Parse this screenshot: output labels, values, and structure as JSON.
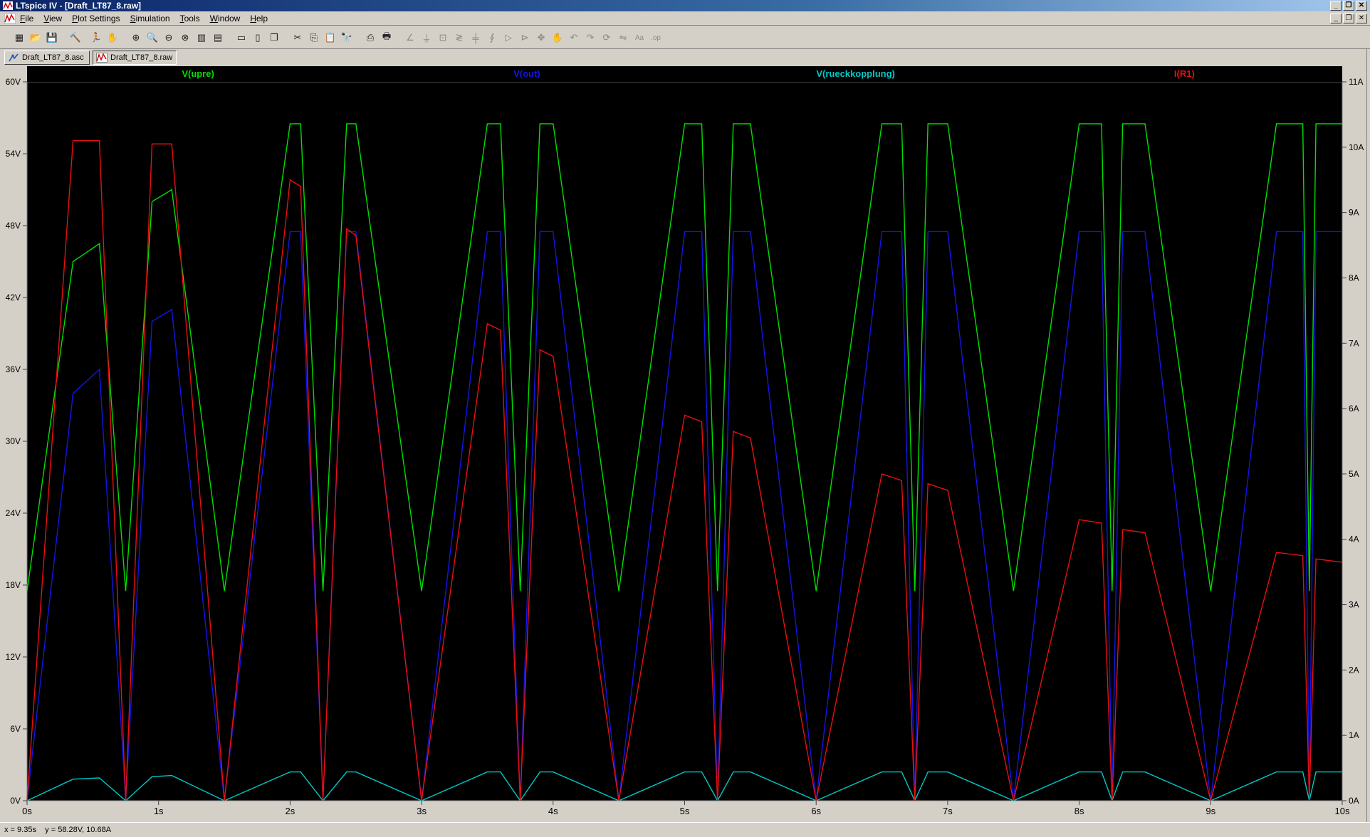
{
  "window": {
    "title": "LTspice IV - [Draft_LT87_8.raw]"
  },
  "menu": [
    "File",
    "View",
    "Plot Settings",
    "Simulation",
    "Tools",
    "Window",
    "Help"
  ],
  "toolbar": {
    "icons": [
      "new-schematic-icon",
      "open-icon",
      "save-icon",
      "control-panel-icon",
      "run-icon",
      "halt-icon",
      "zoom-in-icon",
      "zoom-area-icon",
      "zoom-out-icon",
      "zoom-full-icon",
      "autorange-icon",
      "mark-icon",
      "tile-horizontal-icon",
      "tile-vertical-icon",
      "cascade-icon",
      "cut-icon",
      "copy-icon",
      "paste-icon",
      "find-icon",
      "print-preview-icon",
      "print-icon",
      "wire-icon",
      "ground-icon",
      "label-icon",
      "resistor-icon",
      "capacitor-icon",
      "inductor-icon",
      "diode-icon",
      "component-icon",
      "move-icon",
      "drag-icon",
      "undo-icon",
      "redo-icon",
      "rotate-icon",
      "mirror-icon",
      "text-icon",
      "spice-directive-icon"
    ]
  },
  "tabs": [
    {
      "label": "Draft_LT87_8.asc",
      "icon": "schematic-icon",
      "active": false
    },
    {
      "label": "Draft_LT87_8.raw",
      "icon": "waveform-icon",
      "active": true
    }
  ],
  "status": {
    "text": "x = 9.35s    y = 58.28V, 10.68A"
  },
  "chart_data": {
    "type": "line",
    "x_unit": "s",
    "xlim": [
      0,
      10
    ],
    "x_ticks": [
      "0s",
      "1s",
      "2s",
      "3s",
      "4s",
      "5s",
      "6s",
      "7s",
      "8s",
      "9s",
      "10s"
    ],
    "y_left": {
      "ylim": [
        0,
        60
      ],
      "ticks": [
        "0V",
        "6V",
        "12V",
        "18V",
        "24V",
        "30V",
        "36V",
        "42V",
        "48V",
        "54V",
        "60V"
      ]
    },
    "y_right": {
      "ylim": [
        0,
        11
      ],
      "ticks": [
        "0A",
        "1A",
        "2A",
        "3A",
        "4A",
        "5A",
        "6A",
        "7A",
        "8A",
        "9A",
        "10A",
        "11A"
      ]
    },
    "grid": false,
    "background": "#000000",
    "axis_color": "#808080",
    "series": [
      {
        "name": "V(upre)",
        "color": "#00e000",
        "axis": "left",
        "points": [
          [
            0,
            17.5
          ],
          [
            0.35,
            45
          ],
          [
            0.55,
            46.5
          ],
          [
            0.75,
            17.5
          ],
          [
            0.95,
            50
          ],
          [
            1.1,
            51
          ],
          [
            1.5,
            17.5
          ],
          [
            2.0,
            56.5
          ],
          [
            2.08,
            56.5
          ],
          [
            2.25,
            17.5
          ],
          [
            2.43,
            56.5
          ],
          [
            2.5,
            56.5
          ],
          [
            3.0,
            17.5
          ],
          [
            3.5,
            56.5
          ],
          [
            3.6,
            56.5
          ],
          [
            3.75,
            17.5
          ],
          [
            3.9,
            56.5
          ],
          [
            4.0,
            56.5
          ],
          [
            4.5,
            17.5
          ],
          [
            5.0,
            56.5
          ],
          [
            5.13,
            56.5
          ],
          [
            5.25,
            17.5
          ],
          [
            5.37,
            56.5
          ],
          [
            5.5,
            56.5
          ],
          [
            6.0,
            17.5
          ],
          [
            6.5,
            56.5
          ],
          [
            6.65,
            56.5
          ],
          [
            6.75,
            17.5
          ],
          [
            6.85,
            56.5
          ],
          [
            7.0,
            56.5
          ],
          [
            7.5,
            17.5
          ],
          [
            8.0,
            56.5
          ],
          [
            8.17,
            56.5
          ],
          [
            8.25,
            17.5
          ],
          [
            8.33,
            56.5
          ],
          [
            8.5,
            56.5
          ],
          [
            9.0,
            17.5
          ],
          [
            9.5,
            56.5
          ],
          [
            9.7,
            56.5
          ],
          [
            9.75,
            17.5
          ],
          [
            9.8,
            56.5
          ],
          [
            10.0,
            56.5
          ]
        ]
      },
      {
        "name": "V(out)",
        "color": "#1515e6",
        "axis": "left",
        "points": [
          [
            0,
            0
          ],
          [
            0.35,
            34
          ],
          [
            0.55,
            36
          ],
          [
            0.75,
            0
          ],
          [
            0.95,
            40
          ],
          [
            1.1,
            41
          ],
          [
            1.5,
            0
          ],
          [
            2.0,
            47.5
          ],
          [
            2.08,
            47.5
          ],
          [
            2.25,
            0
          ],
          [
            2.43,
            47.5
          ],
          [
            2.5,
            47.5
          ],
          [
            3.0,
            0
          ],
          [
            3.5,
            47.5
          ],
          [
            3.6,
            47.5
          ],
          [
            3.75,
            0
          ],
          [
            3.9,
            47.5
          ],
          [
            4.0,
            47.5
          ],
          [
            4.5,
            0
          ],
          [
            5.0,
            47.5
          ],
          [
            5.13,
            47.5
          ],
          [
            5.25,
            0
          ],
          [
            5.37,
            47.5
          ],
          [
            5.5,
            47.5
          ],
          [
            6.0,
            0
          ],
          [
            6.5,
            47.5
          ],
          [
            6.65,
            47.5
          ],
          [
            6.75,
            0
          ],
          [
            6.85,
            47.5
          ],
          [
            7.0,
            47.5
          ],
          [
            7.5,
            0
          ],
          [
            8.0,
            47.5
          ],
          [
            8.17,
            47.5
          ],
          [
            8.25,
            0
          ],
          [
            8.33,
            47.5
          ],
          [
            8.5,
            47.5
          ],
          [
            9.0,
            0
          ],
          [
            9.5,
            47.5
          ],
          [
            9.7,
            47.5
          ],
          [
            9.75,
            0
          ],
          [
            9.8,
            47.5
          ],
          [
            10.0,
            47.5
          ]
        ]
      },
      {
        "name": "V(rueckkopplung)",
        "color": "#00c8c8",
        "axis": "left",
        "points": [
          [
            0,
            0
          ],
          [
            0.35,
            1.8
          ],
          [
            0.55,
            1.9
          ],
          [
            0.75,
            0
          ],
          [
            0.95,
            2.0
          ],
          [
            1.1,
            2.1
          ],
          [
            1.5,
            0
          ],
          [
            2.0,
            2.4
          ],
          [
            2.08,
            2.4
          ],
          [
            2.25,
            0
          ],
          [
            2.43,
            2.4
          ],
          [
            2.5,
            2.4
          ],
          [
            3.0,
            0
          ],
          [
            3.5,
            2.4
          ],
          [
            3.6,
            2.4
          ],
          [
            3.75,
            0
          ],
          [
            3.9,
            2.4
          ],
          [
            4.0,
            2.4
          ],
          [
            4.5,
            0
          ],
          [
            5.0,
            2.4
          ],
          [
            5.13,
            2.4
          ],
          [
            5.25,
            0
          ],
          [
            5.37,
            2.4
          ],
          [
            5.5,
            2.4
          ],
          [
            6.0,
            0
          ],
          [
            6.5,
            2.4
          ],
          [
            6.65,
            2.4
          ],
          [
            6.75,
            0
          ],
          [
            6.85,
            2.4
          ],
          [
            7.0,
            2.4
          ],
          [
            7.5,
            0
          ],
          [
            8.0,
            2.4
          ],
          [
            8.17,
            2.4
          ],
          [
            8.25,
            0
          ],
          [
            8.33,
            2.4
          ],
          [
            8.5,
            2.4
          ],
          [
            9.0,
            0
          ],
          [
            9.5,
            2.4
          ],
          [
            9.7,
            2.4
          ],
          [
            9.75,
            0
          ],
          [
            9.8,
            2.4
          ],
          [
            10.0,
            2.4
          ]
        ]
      },
      {
        "name": "I(R1)",
        "color": "#e81010",
        "axis": "right",
        "points": [
          [
            0,
            0
          ],
          [
            0.35,
            10.1
          ],
          [
            0.55,
            10.1
          ],
          [
            0.75,
            0
          ],
          [
            0.95,
            10.05
          ],
          [
            1.1,
            10.05
          ],
          [
            1.5,
            0
          ],
          [
            2.0,
            9.5
          ],
          [
            2.08,
            9.4
          ],
          [
            2.25,
            0
          ],
          [
            2.43,
            8.75
          ],
          [
            2.5,
            8.65
          ],
          [
            3.0,
            0
          ],
          [
            3.5,
            7.3
          ],
          [
            3.6,
            7.2
          ],
          [
            3.75,
            0
          ],
          [
            3.9,
            6.9
          ],
          [
            4.0,
            6.8
          ],
          [
            4.5,
            0
          ],
          [
            5.0,
            5.9
          ],
          [
            5.13,
            5.8
          ],
          [
            5.25,
            0
          ],
          [
            5.37,
            5.65
          ],
          [
            5.5,
            5.55
          ],
          [
            6.0,
            0
          ],
          [
            6.5,
            5.0
          ],
          [
            6.65,
            4.9
          ],
          [
            6.75,
            0
          ],
          [
            6.85,
            4.85
          ],
          [
            7.0,
            4.75
          ],
          [
            7.5,
            0
          ],
          [
            8.0,
            4.3
          ],
          [
            8.17,
            4.25
          ],
          [
            8.25,
            0
          ],
          [
            8.33,
            4.15
          ],
          [
            8.5,
            4.1
          ],
          [
            9.0,
            0
          ],
          [
            9.5,
            3.8
          ],
          [
            9.7,
            3.75
          ],
          [
            9.75,
            0
          ],
          [
            9.8,
            3.7
          ],
          [
            10.0,
            3.65
          ]
        ]
      }
    ]
  }
}
